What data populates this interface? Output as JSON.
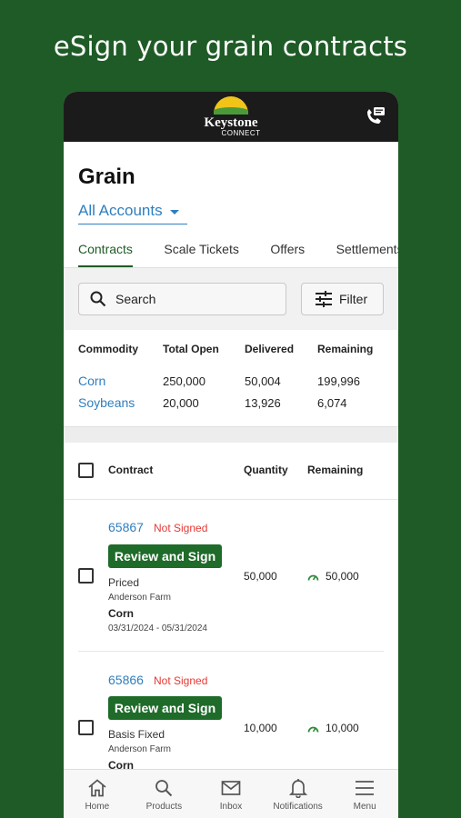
{
  "headline": "eSign your grain contracts",
  "brand": {
    "name": "Keystone",
    "sub": "CONNECT"
  },
  "page": {
    "title": "Grain",
    "account_selector": "All Accounts"
  },
  "tabs": [
    {
      "label": "Contracts",
      "active": true
    },
    {
      "label": "Scale Tickets",
      "active": false
    },
    {
      "label": "Offers",
      "active": false
    },
    {
      "label": "Settlements",
      "active": false
    }
  ],
  "search": {
    "label": "Search"
  },
  "filter": {
    "label": "Filter"
  },
  "summary": {
    "headers": [
      "Commodity",
      "Total Open",
      "Delivered",
      "Remaining"
    ],
    "rows": [
      {
        "commodity": "Corn",
        "total_open": "250,000",
        "delivered": "50,004",
        "remaining": "199,996"
      },
      {
        "commodity": "Soybeans",
        "total_open": "20,000",
        "delivered": "13,926",
        "remaining": "6,074"
      }
    ]
  },
  "contracts_header": {
    "contract": "Contract",
    "quantity": "Quantity",
    "remaining": "Remaining"
  },
  "contracts": [
    {
      "number": "65867",
      "status": "Not Signed",
      "action": "Review and Sign",
      "type": "Priced",
      "farm": "Anderson Farm",
      "commodity": "Corn",
      "dates": "03/31/2024 - 05/31/2024",
      "quantity": "50,000",
      "remaining": "50,000"
    },
    {
      "number": "65866",
      "status": "Not Signed",
      "action": "Review and Sign",
      "type": "Basis Fixed",
      "farm": "Anderson Farm",
      "commodity": "Corn",
      "quantity": "10,000",
      "remaining": "10,000"
    }
  ],
  "bottom_nav": [
    {
      "label": "Home",
      "icon": "home-icon"
    },
    {
      "label": "Products",
      "icon": "search-icon"
    },
    {
      "label": "Inbox",
      "icon": "mail-icon"
    },
    {
      "label": "Notifications",
      "icon": "bell-icon"
    },
    {
      "label": "Menu",
      "icon": "menu-icon"
    }
  ],
  "colors": {
    "brand_green": "#1f5b26",
    "link_blue": "#2f7fbf",
    "alert_red": "#e53935",
    "button_green": "#1f6b2a"
  }
}
